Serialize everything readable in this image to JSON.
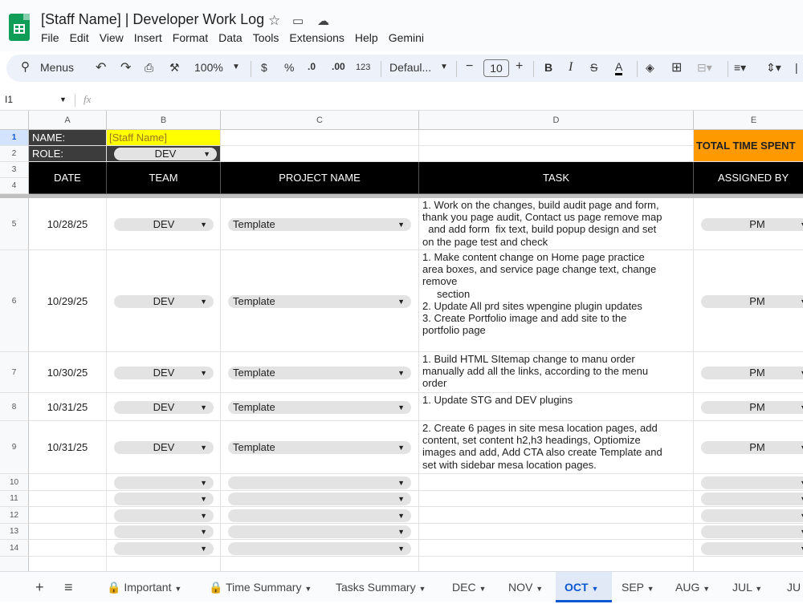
{
  "app": {
    "title": "[Staff Name] | Developer Work Log",
    "menu": [
      "File",
      "Edit",
      "View",
      "Insert",
      "Format",
      "Data",
      "Tools",
      "Extensions",
      "Help",
      "Gemini"
    ]
  },
  "toolbar": {
    "search_label": "Menus",
    "zoom": "100%",
    "currency": "$",
    "percent": "%",
    "dec_decrease": ".0",
    "dec_increase": ".00",
    "number_format": "123",
    "font": "Defaul...",
    "font_size": "10"
  },
  "formula_bar": {
    "cell_ref": "I1",
    "fx": "fx",
    "value": ""
  },
  "columns": [
    "A",
    "B",
    "C",
    "D",
    "E"
  ],
  "sheet": {
    "name_label": "NAME:",
    "name_value": "[Staff Name]",
    "role_label": "ROLE:",
    "role_value": "DEV",
    "total_time": "TOTAL TIME SPENT",
    "headers": {
      "date": "DATE",
      "team": "TEAM",
      "project": "PROJECT NAME",
      "task": "TASK",
      "assigned": "ASSIGNED BY"
    },
    "row_numbers": [
      "1",
      "2",
      "3",
      "4",
      "5",
      "6",
      "7",
      "8",
      "9",
      "10",
      "11",
      "12",
      "13",
      "14"
    ],
    "rows": [
      {
        "date": "10/28/25",
        "team": "DEV",
        "project": "Template",
        "assigned": "PM",
        "task": [
          "1. Work on the changes, build audit page and form,",
          "thank you page audit, Contact us page remove map",
          "  and add form  fix text, build popup design and set",
          "on the page test and check"
        ]
      },
      {
        "date": "10/29/25",
        "team": "DEV",
        "project": "Template",
        "assigned": "PM",
        "task": [
          "1. Make content change on Home page practice",
          "area boxes, and service page change text, change",
          "remove",
          "     section",
          "2. Update All prd sites wpengine plugin updates",
          "3. Create Portfolio image and add site to the",
          "portfolio page"
        ]
      },
      {
        "date": "10/30/25",
        "team": "DEV",
        "project": "Template",
        "assigned": "PM",
        "task": [
          "1. Build HTML SItemap change to manu order",
          "manually add all the links, according to the menu",
          "order"
        ]
      },
      {
        "date": "10/31/25",
        "team": "DEV",
        "project": "Template",
        "assigned": "PM",
        "task": [
          "1. Update STG and DEV plugins"
        ]
      },
      {
        "date": "10/31/25",
        "team": "DEV",
        "project": "Template",
        "assigned": "PM",
        "task": [
          "2. Create 6 pages in site mesa location pages, add",
          "content, set content h2,h3 headings, Optiomize",
          "images and add, Add CTA also create Template and",
          "set with sidebar mesa location pages."
        ]
      }
    ]
  },
  "tabs": [
    {
      "label": "Important",
      "lock": true
    },
    {
      "label": "Time Summary",
      "lock": true
    },
    {
      "label": "Tasks Summary",
      "lock": false
    },
    {
      "label": "DEC",
      "lock": false
    },
    {
      "label": "NOV",
      "lock": false
    },
    {
      "label": "OCT",
      "lock": false,
      "active": true
    },
    {
      "label": "SEP",
      "lock": false
    },
    {
      "label": "AUG",
      "lock": false
    },
    {
      "label": "JUL",
      "lock": false
    },
    {
      "label": "JU",
      "lock": false
    }
  ],
  "colors": {
    "header_black": "#000000",
    "name_yellow": "#ffff00",
    "total_orange": "#ff9900",
    "dark_label": "#3c3c3c",
    "accent": "#0b57d0"
  }
}
